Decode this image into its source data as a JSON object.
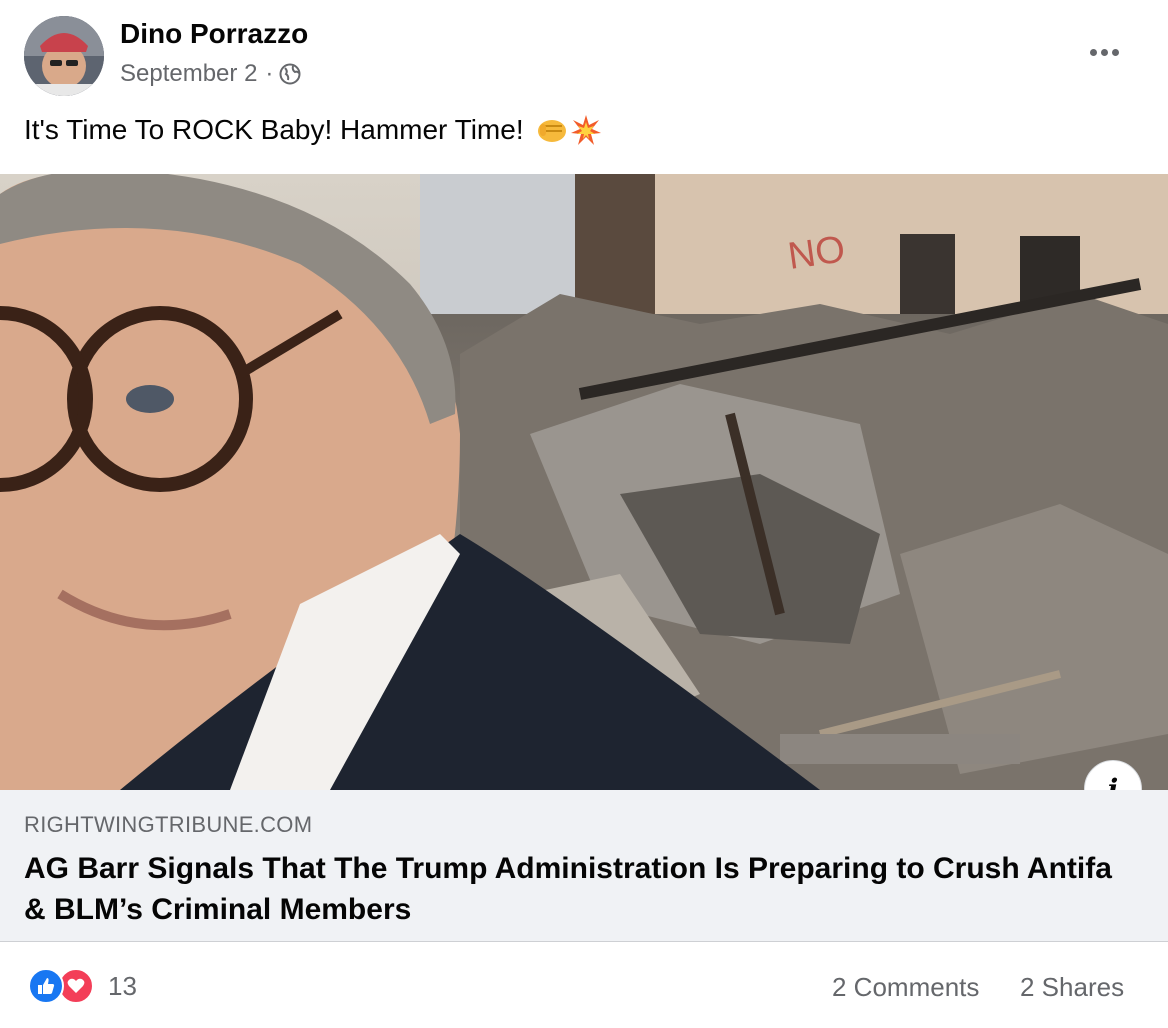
{
  "post": {
    "author": "Dino Porrazzo",
    "date": "September 2",
    "separator": "·",
    "privacy_icon": "globe-icon",
    "more_icon": "more-options-icon",
    "text": "It's Time To ROCK Baby!  Hammer Time!",
    "emojis": [
      "oncoming-fist-emoji",
      "collision-emoji"
    ]
  },
  "link": {
    "domain": "RIGHTWINGTRIBUNE.COM",
    "title": "AG Barr Signals That The Trump Administration Is Preparing to Crush Antifa & BLM’s Criminal Members",
    "info_icon_label": "i"
  },
  "footer": {
    "reaction_icons": [
      "like-icon",
      "love-icon"
    ],
    "reaction_count": "13",
    "comments": "2 Comments",
    "shares": "2 Shares"
  },
  "colors": {
    "secondary_text": "#65676b",
    "like_blue": "#1877f2",
    "love_red": "#f33e58",
    "link_box_bg": "#f0f2f5"
  }
}
